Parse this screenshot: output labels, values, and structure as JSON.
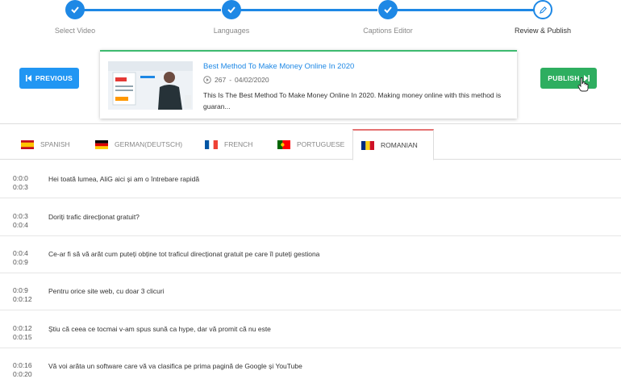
{
  "stepper": {
    "steps": [
      {
        "label": "Select Video"
      },
      {
        "label": "Languages"
      },
      {
        "label": "Captions Editor"
      },
      {
        "label": "Review & Publish"
      }
    ]
  },
  "buttons": {
    "previous_label": "PREVIOUS",
    "publish_label": "PUBLISH"
  },
  "video": {
    "title": "Best Method To Make Money Online In 2020",
    "views": "267",
    "date": "04/02/2020",
    "meta_separator": "-",
    "description": "This Is The Best Method To Make Money Online In 2020. Making money online with this method is guaran..."
  },
  "tabs": [
    {
      "label": "SPANISH",
      "icon": "spain-flag"
    },
    {
      "label": "GERMAN(DEUTSCH)",
      "icon": "germany-flag"
    },
    {
      "label": "FRENCH",
      "icon": "france-flag"
    },
    {
      "label": "PORTUGUESE",
      "icon": "portugal-flag"
    },
    {
      "label": "ROMANIAN",
      "icon": "romania-flag",
      "active": true
    }
  ],
  "captions": [
    {
      "start": "0:0:0",
      "end": "0:0:3",
      "text": "Hei toată lumea, AliG aici și am o întrebare rapidă"
    },
    {
      "start": "0:0:3",
      "end": "0:0:4",
      "text": "Doriți trafic direcționat gratuit?"
    },
    {
      "start": "0:0:4",
      "end": "0:0:9",
      "text": "Ce-ar fi să vă arăt cum puteți obține tot traficul direcționat gratuit pe care îl puteți gestiona"
    },
    {
      "start": "0:0:9",
      "end": "0:0:12",
      "text": "Pentru orice site web, cu doar 3 clicuri"
    },
    {
      "start": "0:0:12",
      "end": "0:0:15",
      "text": "Știu că ceea ce tocmai v-am spus sună ca hype, dar vă promit că nu este"
    },
    {
      "start": "0:0:16",
      "end": "0:0:20",
      "text": "Vă voi arăta un software care vă va clasifica pe prima pagină de Google și YouTube"
    }
  ],
  "colors": {
    "accent": "#1e88e5",
    "publish": "#2eae60",
    "active_tab": "#e57373"
  }
}
